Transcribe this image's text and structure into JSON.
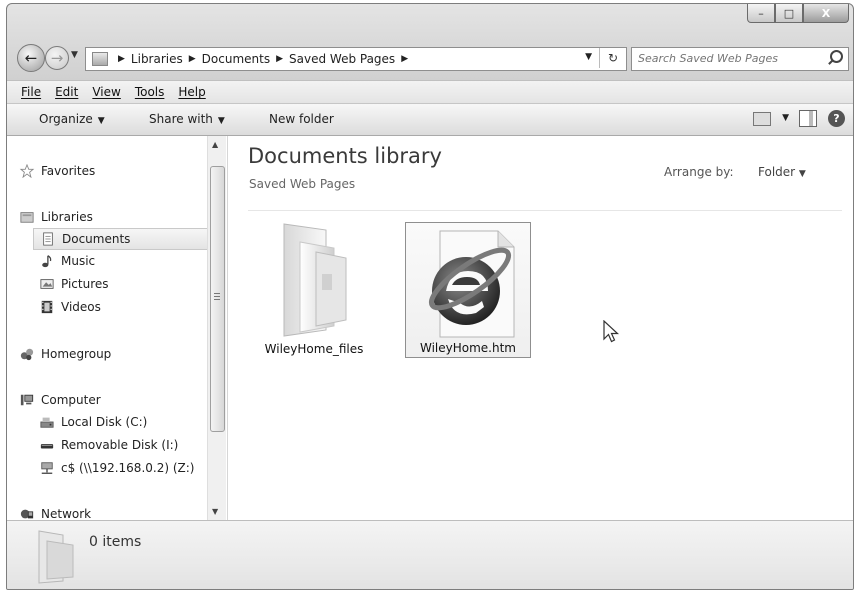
{
  "window": {
    "min_glyph": "–",
    "max_glyph": "□",
    "close_glyph": "X"
  },
  "address": {
    "crumbs": [
      "Libraries",
      "Documents",
      "Saved Web Pages"
    ],
    "refresh_glyph": "↻"
  },
  "search": {
    "placeholder": "Search Saved Web Pages"
  },
  "menu": {
    "items": [
      "File",
      "Edit",
      "View",
      "Tools",
      "Help"
    ]
  },
  "toolbar": {
    "organize": "Organize",
    "share_with": "Share with",
    "new_folder": "New folder",
    "help_glyph": "?"
  },
  "nav": {
    "favorites": "Favorites",
    "libraries": "Libraries",
    "documents": "Documents",
    "music": "Music",
    "pictures": "Pictures",
    "videos": "Videos",
    "homegroup": "Homegroup",
    "computer": "Computer",
    "local_disk": "Local Disk (C:)",
    "removable": "Removable Disk (I:)",
    "network_drive": "c$ (\\\\192.168.0.2) (Z:)",
    "network": "Network"
  },
  "library": {
    "title": "Documents library",
    "subtitle": "Saved Web Pages",
    "arrange_label": "Arrange by:",
    "arrange_value": "Folder"
  },
  "files": [
    {
      "name": "WileyHome_files",
      "type": "folder"
    },
    {
      "name": "WileyHome.htm",
      "type": "html-document"
    }
  ],
  "details": {
    "count": "0 items"
  }
}
